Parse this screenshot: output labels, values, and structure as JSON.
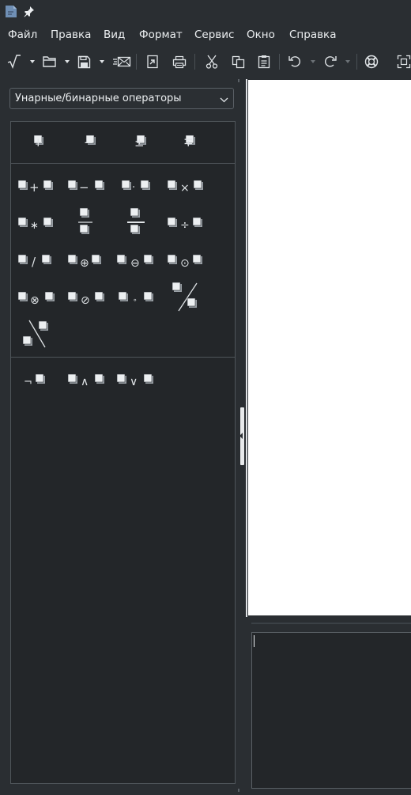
{
  "menu": [
    "Файл",
    "Правка",
    "Вид",
    "Формат",
    "Сервис",
    "Окно",
    "Справка"
  ],
  "toolbar": {
    "icons": [
      "formula-sqrt-icon",
      "new-document-icon",
      "open-folder-icon",
      "save-icon",
      "email-icon",
      "export-pdf-icon",
      "print-icon",
      "cut-icon",
      "copy-icon",
      "paste-icon",
      "undo-icon",
      "redo-icon",
      "help-lifebuoy-icon",
      "zoom-icon"
    ]
  },
  "elements": {
    "category": "Унарные/бинарные операторы",
    "unary": [
      "+",
      "−",
      "±",
      "∓"
    ],
    "binary": [
      "+",
      "−",
      "·",
      "×",
      "∗",
      "÷",
      "/",
      "⊕",
      "⊖",
      "⊙",
      "⊗",
      "⊘",
      "∘"
    ],
    "logic": [
      "¬",
      "∧",
      "∨"
    ]
  },
  "command_text": ""
}
